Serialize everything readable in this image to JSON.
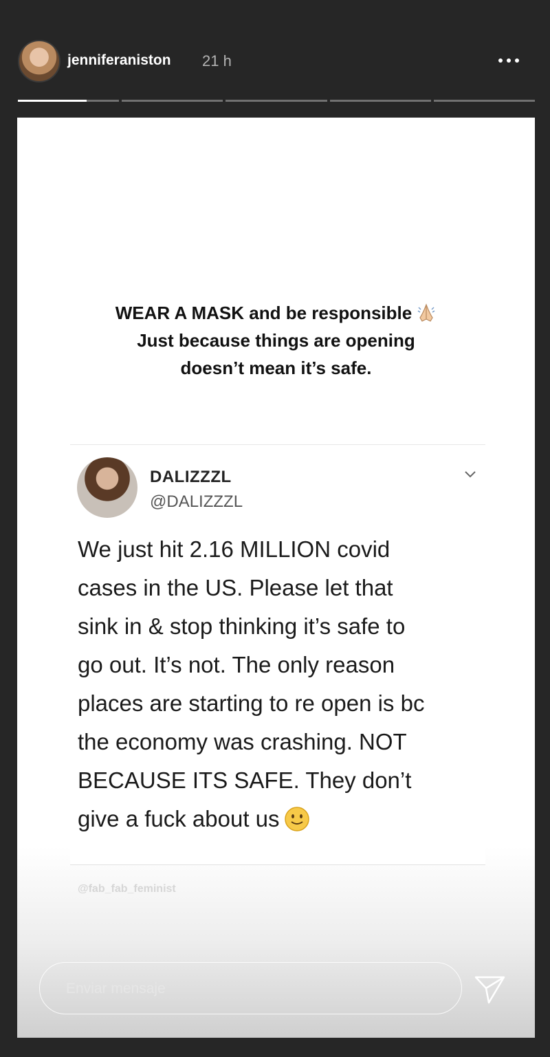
{
  "header": {
    "username": "jenniferaniston",
    "time": "21 h",
    "more_icon": "more-horizontal-icon"
  },
  "progress": {
    "segments": 5,
    "active_index": 0,
    "active_fill": 0.68
  },
  "story": {
    "caption": {
      "line1": "WEAR A MASK and be responsible",
      "line2": "Just because things are opening",
      "line3": "doesn’t mean it’s safe.",
      "emoji": "folded-hands-icon"
    },
    "tweet": {
      "name": "DALIZZZL",
      "handle": "@DALIZZZL",
      "menu_icon": "chevron-down-icon",
      "lines": [
        "We just hit 2.16 MILLION covid",
        "cases in the US. Please let that",
        "sink in & stop thinking it’s safe to",
        "go out. It’s not. The only reason",
        "places are starting to re open is bc",
        "the economy was crashing. NOT",
        "BECAUSE ITS SAFE. They don’t",
        "give a fuck about us"
      ],
      "emoji": "slightly-smiling-face-icon"
    },
    "watermark": "@fab_fab_feminist"
  },
  "footer": {
    "message_placeholder": "Enviar mensaje",
    "send_icon": "send-icon"
  }
}
